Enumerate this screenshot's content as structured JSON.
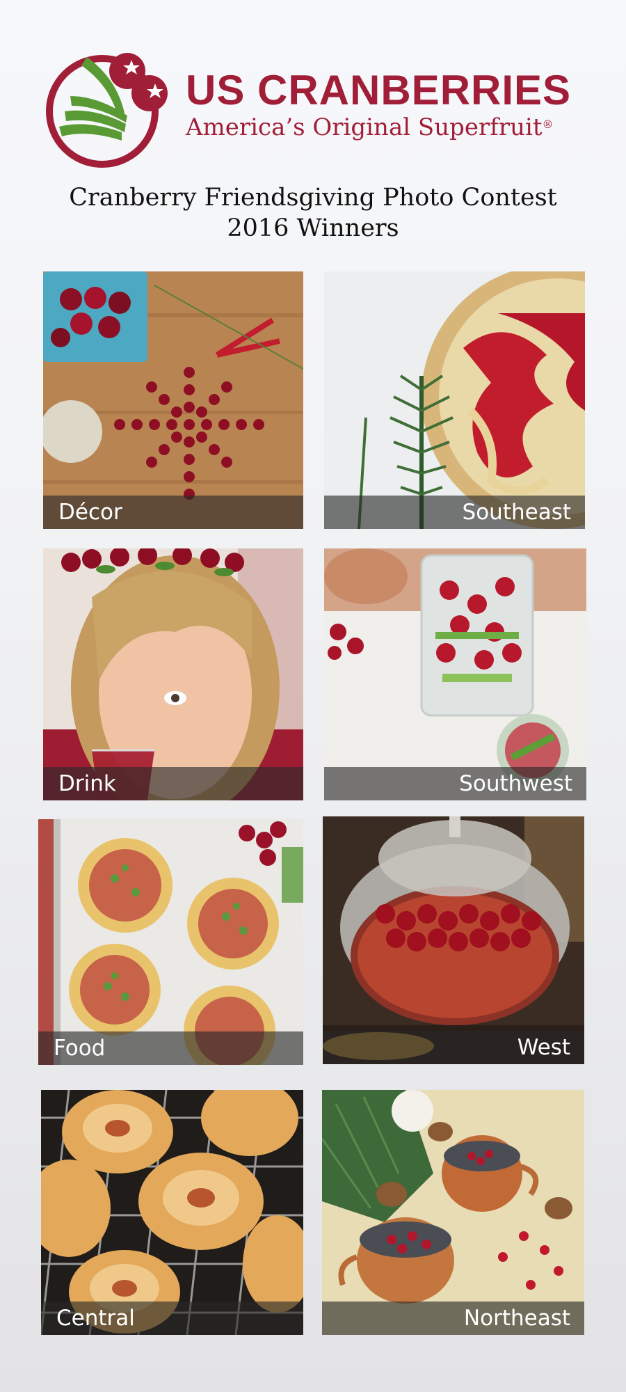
{
  "brand": {
    "name": "US CRANBERRIES",
    "tagline": "America’s Original Superfruit",
    "registered_mark": "®"
  },
  "title": {
    "line1": "Cranberry Friendsgiving Photo Contest",
    "line2": "2016 Winners"
  },
  "tiles": [
    {
      "label": "Décor"
    },
    {
      "label": "Southeast"
    },
    {
      "label": "Drink"
    },
    {
      "label": "Southwest"
    },
    {
      "label": "Food"
    },
    {
      "label": "West"
    },
    {
      "label": "Central"
    },
    {
      "label": "Northeast"
    }
  ],
  "colors": {
    "brand_red": "#a01e37",
    "leaf_green": "#5a9a35"
  }
}
